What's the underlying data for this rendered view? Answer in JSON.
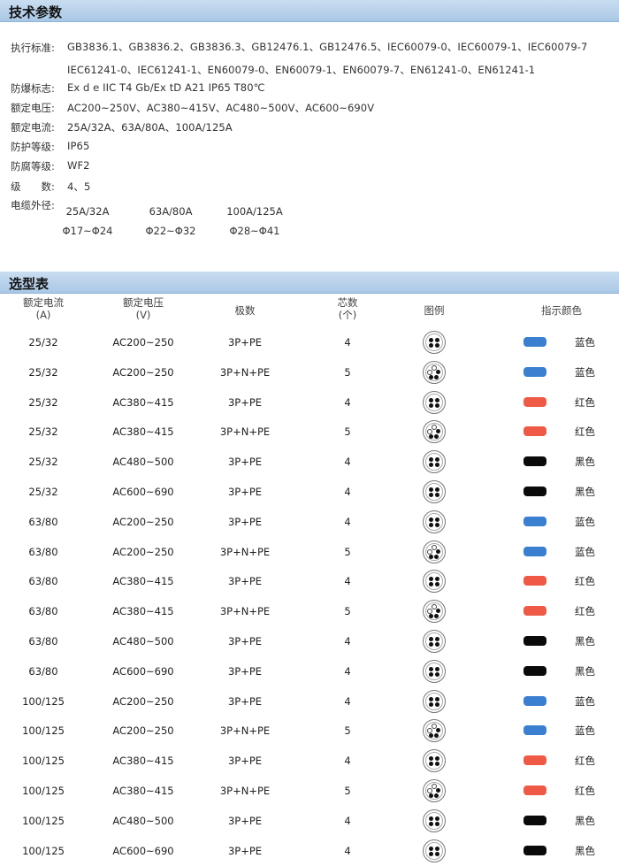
{
  "sections": {
    "specs_title": "技术参数",
    "select_title": "选型表"
  },
  "specs": [
    {
      "label": "执行标准:",
      "value": "GB3836.1、GB3836.2、GB3836.3、GB12476.1、GB12476.5、IEC60079-0、IEC60079-1、IEC60079-7 IEC61241-0、IEC61241-1、EN60079-0、EN60079-1、EN60079-7、EN61241-0、EN61241-1"
    },
    {
      "label": "防爆标志:",
      "value": "Ex d e IIC T4 Gb/Ex tD A21 IP65 T80℃"
    },
    {
      "label": "额定电压:",
      "value": "AC200~250V、AC380~415V、AC480~500V、AC600~690V"
    },
    {
      "label": "额定电流:",
      "value": "25A/32A、63A/80A、100A/125A"
    },
    {
      "label": "防护等级:",
      "value": "IP65"
    },
    {
      "label": "防腐等级:",
      "value": "WF2"
    },
    {
      "label": "级　　数:",
      "value": "4、5"
    },
    {
      "label": "电缆外径:",
      "value": ""
    }
  ],
  "cable": [
    {
      "current": "25A/32A",
      "diameter": "Φ17~Φ24"
    },
    {
      "current": "63A/80A",
      "diameter": "Φ22~Φ32"
    },
    {
      "current": "100A/125A",
      "diameter": "Φ28~Φ41"
    }
  ],
  "table": {
    "headers": {
      "current": [
        "额定电流",
        "(A)"
      ],
      "voltage": [
        "额定电压",
        "(V)"
      ],
      "poles": "极数",
      "cores": [
        "芯数",
        "(个)"
      ],
      "figure": "图例",
      "color": "指示颜色"
    },
    "colors": {
      "blue": "#3a7fd0",
      "red": "#ee5a45",
      "black": "#0a0a0a"
    },
    "rows": [
      {
        "current": "25/32",
        "voltage": "AC200~250",
        "poles": "3P+PE",
        "cores": "4",
        "color": "blue",
        "color_name": "蓝色"
      },
      {
        "current": "25/32",
        "voltage": "AC200~250",
        "poles": "3P+N+PE",
        "cores": "5",
        "color": "blue",
        "color_name": "蓝色"
      },
      {
        "current": "25/32",
        "voltage": "AC380~415",
        "poles": "3P+PE",
        "cores": "4",
        "color": "red",
        "color_name": "红色"
      },
      {
        "current": "25/32",
        "voltage": "AC380~415",
        "poles": "3P+N+PE",
        "cores": "5",
        "color": "red",
        "color_name": "红色"
      },
      {
        "current": "25/32",
        "voltage": "AC480~500",
        "poles": "3P+PE",
        "cores": "4",
        "color": "black",
        "color_name": "黑色"
      },
      {
        "current": "25/32",
        "voltage": "AC600~690",
        "poles": "3P+PE",
        "cores": "4",
        "color": "black",
        "color_name": "黑色"
      },
      {
        "current": "63/80",
        "voltage": "AC200~250",
        "poles": "3P+PE",
        "cores": "4",
        "color": "blue",
        "color_name": "蓝色"
      },
      {
        "current": "63/80",
        "voltage": "AC200~250",
        "poles": "3P+N+PE",
        "cores": "5",
        "color": "blue",
        "color_name": "蓝色"
      },
      {
        "current": "63/80",
        "voltage": "AC380~415",
        "poles": "3P+PE",
        "cores": "4",
        "color": "red",
        "color_name": "红色"
      },
      {
        "current": "63/80",
        "voltage": "AC380~415",
        "poles": "3P+N+PE",
        "cores": "5",
        "color": "red",
        "color_name": "红色"
      },
      {
        "current": "63/80",
        "voltage": "AC480~500",
        "poles": "3P+PE",
        "cores": "4",
        "color": "black",
        "color_name": "黑色"
      },
      {
        "current": "63/80",
        "voltage": "AC600~690",
        "poles": "3P+PE",
        "cores": "4",
        "color": "black",
        "color_name": "黑色"
      },
      {
        "current": "100/125",
        "voltage": "AC200~250",
        "poles": "3P+PE",
        "cores": "4",
        "color": "blue",
        "color_name": "蓝色"
      },
      {
        "current": "100/125",
        "voltage": "AC200~250",
        "poles": "3P+N+PE",
        "cores": "5",
        "color": "blue",
        "color_name": "蓝色"
      },
      {
        "current": "100/125",
        "voltage": "AC380~415",
        "poles": "3P+PE",
        "cores": "4",
        "color": "red",
        "color_name": "红色"
      },
      {
        "current": "100/125",
        "voltage": "AC380~415",
        "poles": "3P+N+PE",
        "cores": "5",
        "color": "red",
        "color_name": "红色"
      },
      {
        "current": "100/125",
        "voltage": "AC480~500",
        "poles": "3P+PE",
        "cores": "4",
        "color": "black",
        "color_name": "黑色"
      },
      {
        "current": "100/125",
        "voltage": "AC600~690",
        "poles": "3P+PE",
        "cores": "4",
        "color": "black",
        "color_name": "黑色"
      }
    ]
  }
}
